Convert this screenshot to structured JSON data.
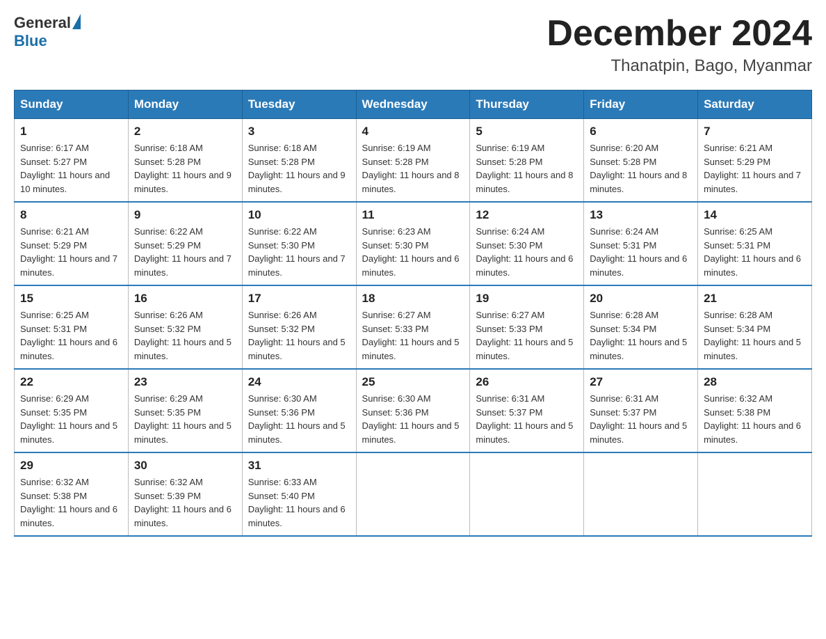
{
  "header": {
    "logo_general": "General",
    "logo_blue": "Blue",
    "month_title": "December 2024",
    "location": "Thanatpin, Bago, Myanmar"
  },
  "days_of_week": [
    "Sunday",
    "Monday",
    "Tuesday",
    "Wednesday",
    "Thursday",
    "Friday",
    "Saturday"
  ],
  "weeks": [
    [
      {
        "day": "1",
        "sunrise": "6:17 AM",
        "sunset": "5:27 PM",
        "daylight": "11 hours and 10 minutes."
      },
      {
        "day": "2",
        "sunrise": "6:18 AM",
        "sunset": "5:28 PM",
        "daylight": "11 hours and 9 minutes."
      },
      {
        "day": "3",
        "sunrise": "6:18 AM",
        "sunset": "5:28 PM",
        "daylight": "11 hours and 9 minutes."
      },
      {
        "day": "4",
        "sunrise": "6:19 AM",
        "sunset": "5:28 PM",
        "daylight": "11 hours and 8 minutes."
      },
      {
        "day": "5",
        "sunrise": "6:19 AM",
        "sunset": "5:28 PM",
        "daylight": "11 hours and 8 minutes."
      },
      {
        "day": "6",
        "sunrise": "6:20 AM",
        "sunset": "5:28 PM",
        "daylight": "11 hours and 8 minutes."
      },
      {
        "day": "7",
        "sunrise": "6:21 AM",
        "sunset": "5:29 PM",
        "daylight": "11 hours and 7 minutes."
      }
    ],
    [
      {
        "day": "8",
        "sunrise": "6:21 AM",
        "sunset": "5:29 PM",
        "daylight": "11 hours and 7 minutes."
      },
      {
        "day": "9",
        "sunrise": "6:22 AM",
        "sunset": "5:29 PM",
        "daylight": "11 hours and 7 minutes."
      },
      {
        "day": "10",
        "sunrise": "6:22 AM",
        "sunset": "5:30 PM",
        "daylight": "11 hours and 7 minutes."
      },
      {
        "day": "11",
        "sunrise": "6:23 AM",
        "sunset": "5:30 PM",
        "daylight": "11 hours and 6 minutes."
      },
      {
        "day": "12",
        "sunrise": "6:24 AM",
        "sunset": "5:30 PM",
        "daylight": "11 hours and 6 minutes."
      },
      {
        "day": "13",
        "sunrise": "6:24 AM",
        "sunset": "5:31 PM",
        "daylight": "11 hours and 6 minutes."
      },
      {
        "day": "14",
        "sunrise": "6:25 AM",
        "sunset": "5:31 PM",
        "daylight": "11 hours and 6 minutes."
      }
    ],
    [
      {
        "day": "15",
        "sunrise": "6:25 AM",
        "sunset": "5:31 PM",
        "daylight": "11 hours and 6 minutes."
      },
      {
        "day": "16",
        "sunrise": "6:26 AM",
        "sunset": "5:32 PM",
        "daylight": "11 hours and 5 minutes."
      },
      {
        "day": "17",
        "sunrise": "6:26 AM",
        "sunset": "5:32 PM",
        "daylight": "11 hours and 5 minutes."
      },
      {
        "day": "18",
        "sunrise": "6:27 AM",
        "sunset": "5:33 PM",
        "daylight": "11 hours and 5 minutes."
      },
      {
        "day": "19",
        "sunrise": "6:27 AM",
        "sunset": "5:33 PM",
        "daylight": "11 hours and 5 minutes."
      },
      {
        "day": "20",
        "sunrise": "6:28 AM",
        "sunset": "5:34 PM",
        "daylight": "11 hours and 5 minutes."
      },
      {
        "day": "21",
        "sunrise": "6:28 AM",
        "sunset": "5:34 PM",
        "daylight": "11 hours and 5 minutes."
      }
    ],
    [
      {
        "day": "22",
        "sunrise": "6:29 AM",
        "sunset": "5:35 PM",
        "daylight": "11 hours and 5 minutes."
      },
      {
        "day": "23",
        "sunrise": "6:29 AM",
        "sunset": "5:35 PM",
        "daylight": "11 hours and 5 minutes."
      },
      {
        "day": "24",
        "sunrise": "6:30 AM",
        "sunset": "5:36 PM",
        "daylight": "11 hours and 5 minutes."
      },
      {
        "day": "25",
        "sunrise": "6:30 AM",
        "sunset": "5:36 PM",
        "daylight": "11 hours and 5 minutes."
      },
      {
        "day": "26",
        "sunrise": "6:31 AM",
        "sunset": "5:37 PM",
        "daylight": "11 hours and 5 minutes."
      },
      {
        "day": "27",
        "sunrise": "6:31 AM",
        "sunset": "5:37 PM",
        "daylight": "11 hours and 5 minutes."
      },
      {
        "day": "28",
        "sunrise": "6:32 AM",
        "sunset": "5:38 PM",
        "daylight": "11 hours and 6 minutes."
      }
    ],
    [
      {
        "day": "29",
        "sunrise": "6:32 AM",
        "sunset": "5:38 PM",
        "daylight": "11 hours and 6 minutes."
      },
      {
        "day": "30",
        "sunrise": "6:32 AM",
        "sunset": "5:39 PM",
        "daylight": "11 hours and 6 minutes."
      },
      {
        "day": "31",
        "sunrise": "6:33 AM",
        "sunset": "5:40 PM",
        "daylight": "11 hours and 6 minutes."
      },
      null,
      null,
      null,
      null
    ]
  ]
}
